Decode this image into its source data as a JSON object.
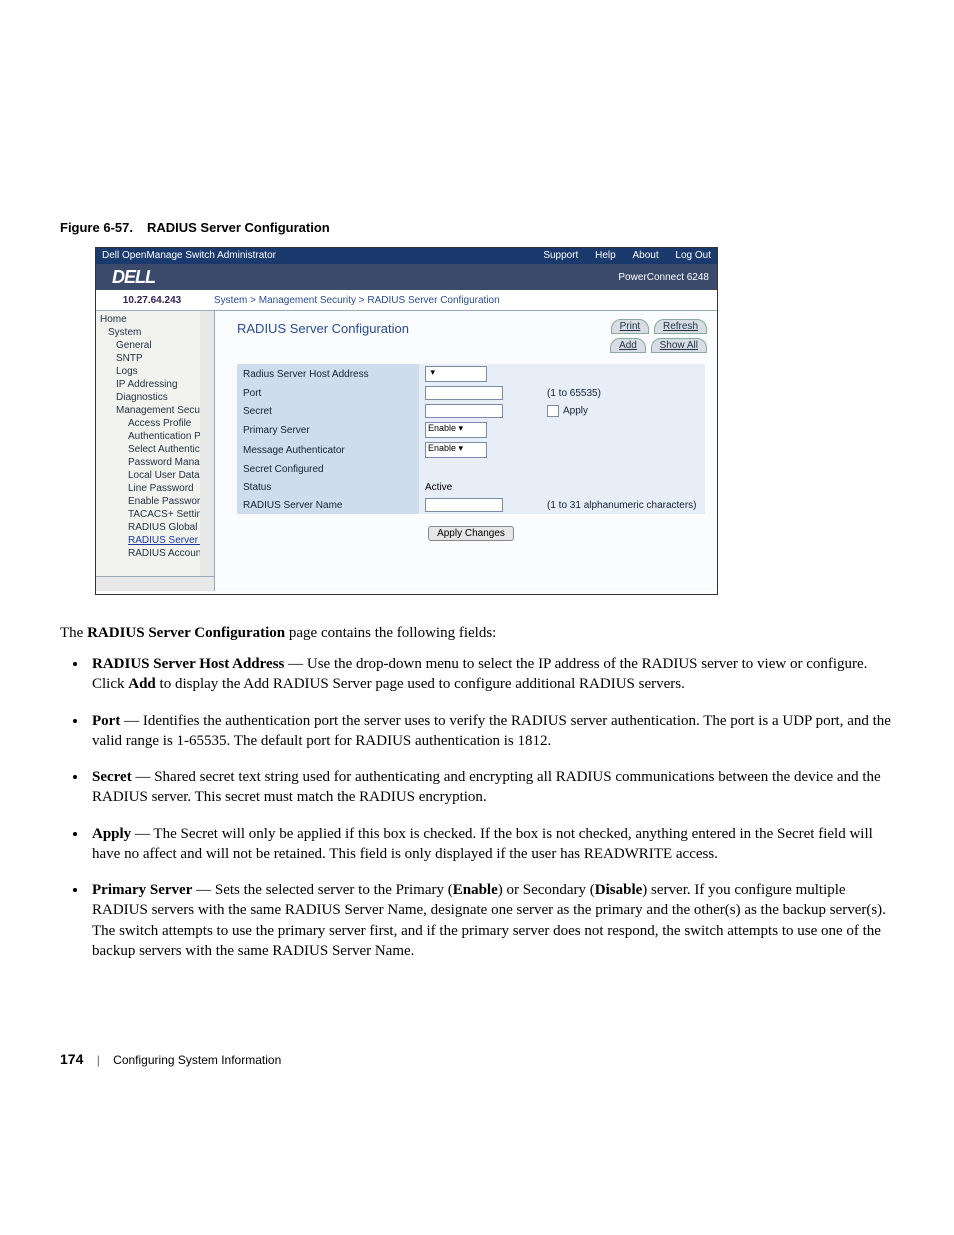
{
  "figure": {
    "num": "Figure 6-57.",
    "title": "RADIUS Server Configuration"
  },
  "shot": {
    "titlebar": {
      "left": "Dell OpenManage Switch Administrator",
      "links": {
        "support": "Support",
        "help": "Help",
        "about": "About",
        "logout": "Log Out"
      }
    },
    "brand": {
      "logo": "DELL",
      "product": "PowerConnect 6248"
    },
    "crumb": {
      "ip": "10.27.64.243",
      "path": "System > Management Security > RADIUS Server Configuration"
    },
    "nav": {
      "home": "Home",
      "system": "System",
      "general": "General",
      "sntp": "SNTP",
      "logs": "Logs",
      "ipaddr": "IP Addressing",
      "diag": "Diagnostics",
      "msec": "Management Security",
      "ap": "Access Profile",
      "authp": "Authentication Profiles",
      "sauth": "Select Authentication",
      "pwm": "Password Managemen",
      "ludb": "Local User Database",
      "lpw": "Line Password",
      "epw": "Enable Password",
      "tac": "TACACS+ Settings",
      "rgc": "RADIUS Global Configu",
      "rsc": "RADIUS Server Configu",
      "rac": "RADIUS Accounting S"
    },
    "main": {
      "heading": "RADIUS Server Configuration",
      "btns": {
        "print": "Print",
        "refresh": "Refresh",
        "add": "Add",
        "showall": "Show All"
      },
      "fields": {
        "host": "Radius Server Host Address",
        "port": "Port",
        "port_hint": "(1 to 65535)",
        "secret": "Secret",
        "apply_cb": "Apply",
        "primary": "Primary Server",
        "primary_val": "Enable",
        "msgauth": "Message Authenticator",
        "msgauth_val": "Enable",
        "sconf": "Secret Configured",
        "status": "Status",
        "status_val": "Active",
        "rname": "RADIUS Server Name",
        "rname_hint": "(1 to 31 alphanumeric characters)"
      },
      "applybtn": "Apply Changes"
    }
  },
  "doc": {
    "lead_pre": "The ",
    "lead_bold": "RADIUS Server Configuration",
    "lead_post": " page contains the following fields:",
    "b1": {
      "name": "RADIUS Server Host Address",
      "pre": " — Use the drop-down menu to select the IP address of the RADIUS server to view or configure. Click ",
      "mid": "Add",
      "post": " to display the Add RADIUS Server page used to configure additional RADIUS servers."
    },
    "b2": {
      "name": "Port",
      "text": " — Identifies the authentication port the server uses to verify the RADIUS server authentication. The port is a UDP port, and the valid range is 1-65535. The default port for RADIUS authentication is 1812."
    },
    "b3": {
      "name": "Secret",
      "text": " — Shared secret text string used for authenticating and encrypting all RADIUS communications between the device and the RADIUS server. This secret must match the RADIUS encryption."
    },
    "b4": {
      "name": "Apply",
      "text": " — The Secret will only be applied if this box is checked. If the box is not checked, anything entered in the Secret field will have no affect and will not be retained. This field is only displayed if the user has READWRITE access."
    },
    "b5": {
      "name": "Primary Server",
      "pre": " — Sets the selected server to the Primary (",
      "en": "Enable",
      "mid": ") or Secondary (",
      "dis": "Disable",
      "post": ") server. If you configure multiple RADIUS servers with the same RADIUS Server Name, designate one server as the primary and the other(s) as the backup server(s). The switch attempts to use the primary server first, and if the primary server does not respond, the switch attempts to use one of the backup servers with the same RADIUS Server Name."
    }
  },
  "footer": {
    "page": "174",
    "section": "Configuring System Information"
  }
}
